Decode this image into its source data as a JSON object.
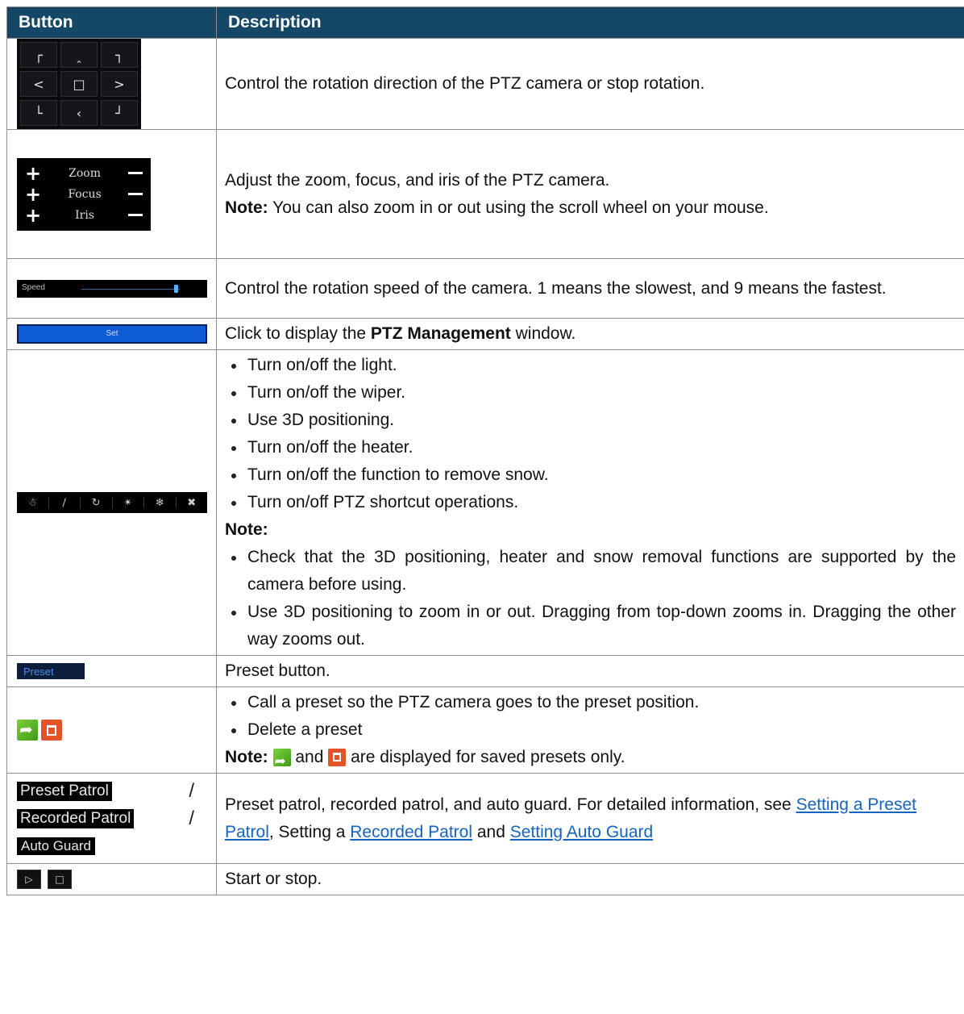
{
  "header": {
    "col_button": "Button",
    "col_description": "Description"
  },
  "icons": {
    "dpad": [
      "┌",
      "‸",
      "┐",
      "<",
      "□",
      ">",
      "└",
      "‹",
      "┘"
    ],
    "icon_row": [
      "light-icon",
      "wiper-icon",
      "3d-positioning-icon",
      "heater-icon",
      "snow-removal-icon",
      "shortcut-icon"
    ],
    "start_stop": [
      "▷",
      "□"
    ]
  },
  "rows": {
    "direction": {
      "desc": "Control the rotation direction of the PTZ camera or stop rotation."
    },
    "lens": {
      "labels": {
        "zoom": "Zoom",
        "focus": "Focus",
        "iris": "Iris"
      },
      "desc": "Adjust the zoom, focus, and iris of the PTZ camera.",
      "note_label": "Note:",
      "note": " You can also zoom in or out using the scroll wheel on your mouse."
    },
    "speed": {
      "label": "Speed",
      "value": 9,
      "desc": "Control the rotation speed of the camera. 1 means the slowest, and 9 means the fastest."
    },
    "set": {
      "button": "Set",
      "desc_pre": "Click to display the ",
      "desc_bold": "PTZ Management",
      "desc_post": " window."
    },
    "functions": {
      "items": [
        "Turn on/off the light.",
        "Turn on/off the wiper.",
        "Use 3D positioning.",
        "Turn on/off the heater.",
        "Turn on/off the function to remove snow.",
        "Turn on/off PTZ shortcut operations."
      ],
      "note_label": "Note:",
      "notes": [
        "Check that the 3D positioning, heater and snow removal functions are supported by the camera before using.",
        "Use 3D positioning to zoom in or out. Dragging from top-down zooms in. Dragging the other way zooms out."
      ]
    },
    "preset": {
      "button": "Preset",
      "desc": "Preset button."
    },
    "call_delete": {
      "items": [
        "Call a preset so the PTZ camera goes to the preset position.",
        "Delete a preset"
      ],
      "note_label": "Note:",
      "note_and": " and ",
      "note_tail": " are displayed for saved presets only."
    },
    "patrol": {
      "buttons": {
        "preset_patrol": "Preset Patrol",
        "recorded_patrol": "Recorded Patrol",
        "auto_guard": "Auto Guard",
        "slash": "/"
      },
      "desc_pre": "Preset patrol, recorded patrol, and auto guard. For detailed information, see ",
      "link1": "Setting a Preset Patrol",
      "mid1": ", Setting a ",
      "link2": "Recorded Patrol",
      "mid2": " and ",
      "link3": "Setting Auto Guard"
    },
    "startstop": {
      "desc": "Start or stop."
    }
  }
}
